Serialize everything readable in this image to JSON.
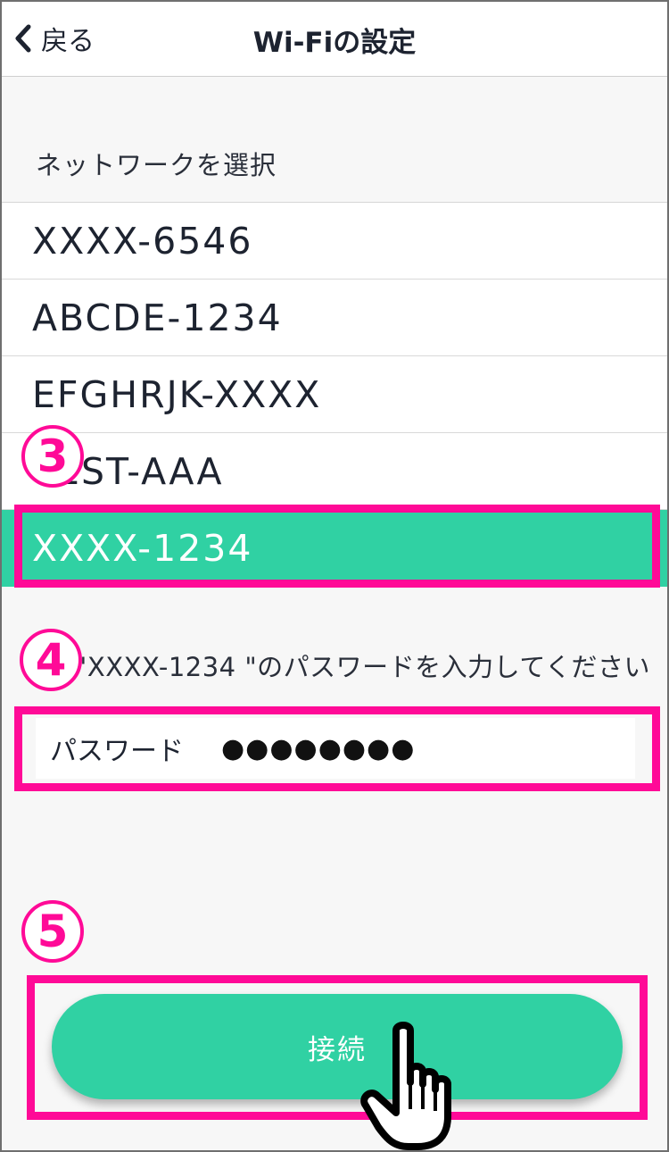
{
  "header": {
    "back_label": "戻る",
    "title": "Wi-Fiの設定"
  },
  "network_section": {
    "label": "ネットワークを選択",
    "items": [
      {
        "name": "XXXX-6546",
        "selected": false
      },
      {
        "name": "ABCDE-1234",
        "selected": false
      },
      {
        "name": "EFGHRJK-XXXX",
        "selected": false
      },
      {
        "name": "TEST-AAA",
        "selected": false
      },
      {
        "name": "XXXX-1234",
        "selected": true
      }
    ]
  },
  "password": {
    "prompt": "\"XXXX-1234 \"のパスワードを入力してください",
    "label": "パスワード",
    "value": "●●●●●●●●"
  },
  "connect": {
    "label": "接続"
  },
  "annotations": {
    "step3": "3",
    "step4": "4",
    "step5": "5"
  },
  "colors": {
    "accent": "#30d1a3",
    "highlight": "#ff0a97",
    "background": "#f7f7f7"
  }
}
